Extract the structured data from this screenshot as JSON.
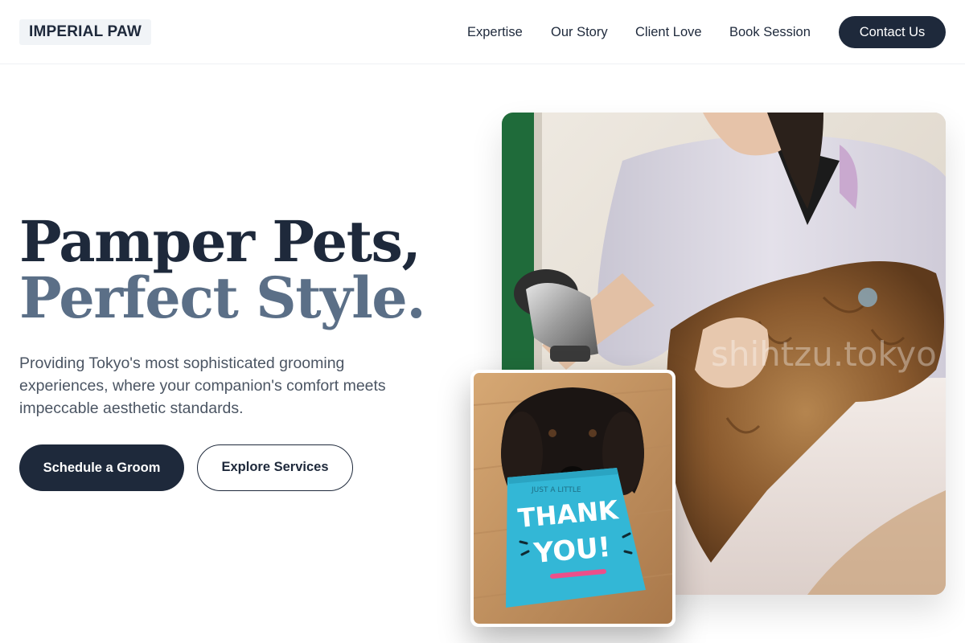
{
  "header": {
    "logo": "IMPERIAL PAW",
    "nav": [
      {
        "label": "Expertise"
      },
      {
        "label": "Our Story"
      },
      {
        "label": "Client Love"
      },
      {
        "label": "Book Session"
      }
    ],
    "contact_label": "Contact Us"
  },
  "hero": {
    "headline_line1": "Pamper Pets,",
    "headline_line2": "Perfect Style.",
    "subtext": "Providing Tokyo's most sophisticated grooming experiences, where your companion's comfort meets impeccable aesthetic standards.",
    "primary_cta": "Schedule a Groom",
    "secondary_cta": "Explore Services"
  },
  "images": {
    "main_photo_watermark": "shihtzu.tokyo",
    "card_text_line1": "THANK",
    "card_text_line2": "YOU!",
    "card_text_small": "JUST A LITTLE"
  },
  "colors": {
    "primary": "#1e293b",
    "accent_headline": "#5b6f87",
    "body_text": "#4b5563"
  }
}
